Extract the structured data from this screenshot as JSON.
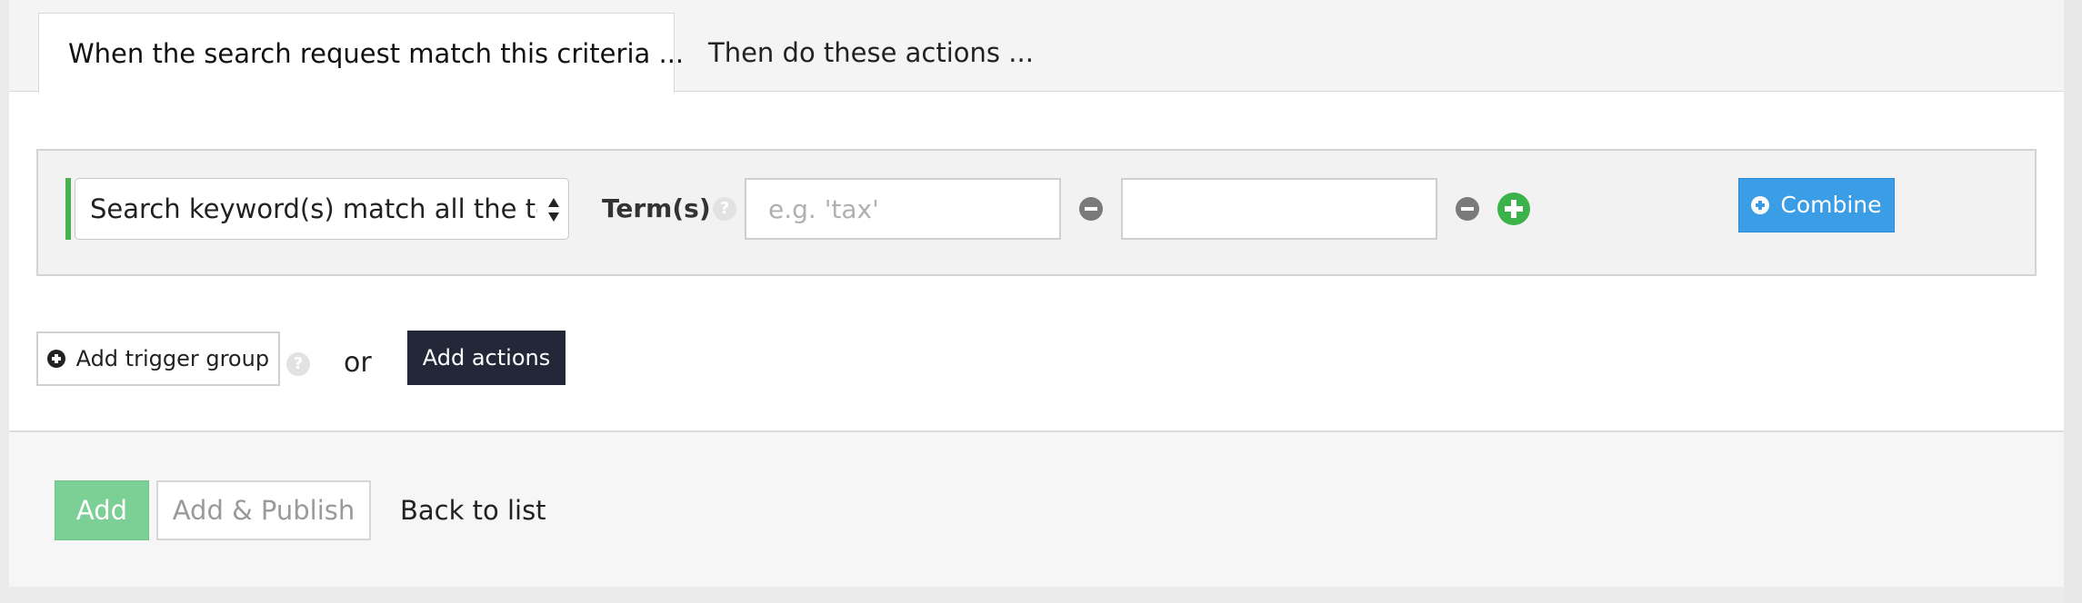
{
  "tabs": [
    {
      "label": "When the search request match this criteria ...",
      "active": true
    },
    {
      "label": "Then do these actions ...",
      "active": false
    }
  ],
  "criteria": {
    "condition_select": "Search keyword(s) match all the terms",
    "terms_label": "Term(s)",
    "term_inputs": [
      {
        "value": "",
        "placeholder": "e.g. 'tax'"
      },
      {
        "value": "",
        "placeholder": ""
      }
    ],
    "combine_label": "Combine"
  },
  "triggers": {
    "add_trigger_group_label": "Add trigger group",
    "or_text": "or",
    "add_actions_label": "Add actions"
  },
  "footer": {
    "add_label": "Add",
    "add_publish_label": "Add & Publish",
    "back_label": "Back to list"
  },
  "colors": {
    "accent_green": "#3cb24a",
    "combine_blue": "#3a9de6",
    "add_actions_dark": "#222838",
    "add_button_green": "#7ccf95",
    "criteria_bar_green": "#4caf50"
  },
  "icons": [
    "help-icon",
    "minus-icon",
    "plus-circle-icon",
    "circle-plus-icon",
    "select-arrows-icon"
  ]
}
